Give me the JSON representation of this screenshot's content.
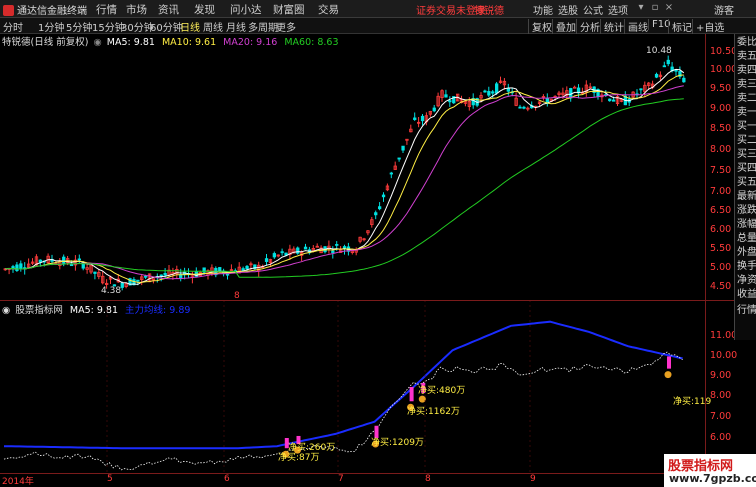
{
  "app": {
    "title": "通达信金融终端",
    "menu": [
      "行情",
      "市场",
      "资讯",
      "发现",
      "问小达",
      "财富圈",
      "交易"
    ],
    "warning": "证券交易未登录",
    "stock_tag": "特锐德",
    "right_menu": [
      "功能",
      "选股",
      "公式",
      "选项"
    ],
    "user": "游客"
  },
  "periods": {
    "items": [
      "分时",
      "1分钟",
      "5分钟",
      "15分钟",
      "30分钟",
      "60分钟",
      "日线",
      "周线",
      "月线",
      "多周期",
      "更多"
    ],
    "active": "日线",
    "buttons": [
      "复权",
      "叠加",
      "分析",
      "统计",
      "画线",
      "F10",
      "标记",
      "+自选"
    ]
  },
  "ma_bar": {
    "title": "特锐德(日线 前复权)",
    "ma5": "MA5: 9.81",
    "ma10": "MA10: 9.61",
    "ma20": "MA20: 9.16",
    "ma60": "MA60: 8.63"
  },
  "indicator_bar": {
    "title": "股票指标网",
    "ma5": "MA5: 9.81",
    "value2": "主力均线: 9.89"
  },
  "right_panel": [
    "委比",
    "卖五",
    "卖四",
    "卖三",
    "卖二",
    "卖一",
    "买一",
    "买二",
    "买三",
    "买四",
    "买五",
    "最新",
    "涨跌",
    "涨幅",
    "总量",
    "外盘",
    "换手",
    "净资",
    "收益",
    "行情"
  ],
  "price_axis": [
    "10.50",
    "10.00",
    "9.50",
    "9.00",
    "8.50",
    "8.00",
    "7.50",
    "7.00",
    "6.50",
    "6.00",
    "5.50",
    "5.00",
    "4.50"
  ],
  "ind_axis": [
    "11.00",
    "10.00",
    "9.00",
    "8.00",
    "7.00",
    "6.00"
  ],
  "dates": [
    "2014年",
    "5",
    "6",
    "7",
    "8",
    "9"
  ],
  "annotations": {
    "high": "10.48",
    "low": "4.38",
    "marker": "8"
  },
  "buy_labels": [
    "净买:260万",
    "净买:87万",
    "净买:1209万",
    "净买:1162万",
    "净买:480万",
    "净买:119"
  ],
  "colors": {
    "up": "#ff3b3b",
    "down": "#00e0e0",
    "ma5": "#ffffff",
    "ma10": "#ffee44",
    "ma20": "#d040d0",
    "ma60": "#22cc22",
    "ind_main": "#1a2cff",
    "bar": "#ff33cc"
  },
  "watermark": {
    "line1": "股票指标网",
    "line2": "www.7gpzb.com"
  }
}
